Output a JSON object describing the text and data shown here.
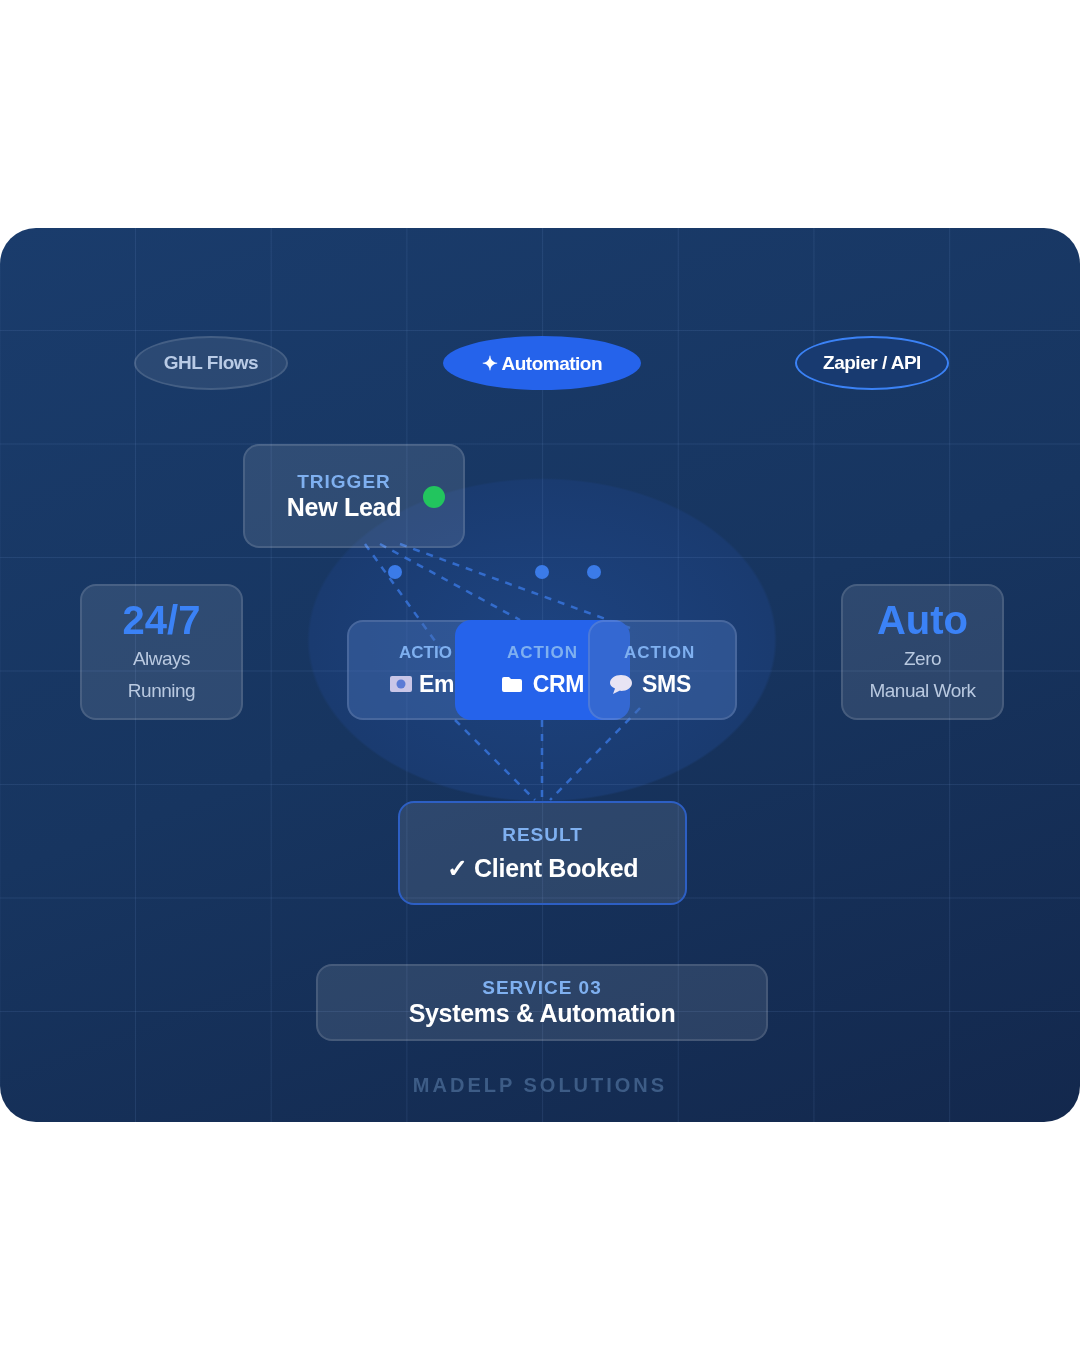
{
  "pills": [
    {
      "label": "GHL Flows",
      "kind": "muted"
    },
    {
      "label": "✦ Automation",
      "kind": "filled"
    },
    {
      "label": "Zapier / API",
      "kind": "outlined"
    }
  ],
  "trigger": {
    "label": "TRIGGER",
    "title": "New Lead",
    "color": "#22c55e"
  },
  "stats": [
    {
      "value": "24/7",
      "caption_lines": [
        "Always",
        "Running"
      ]
    },
    {
      "value": "Auto",
      "caption_lines": [
        "Zero",
        "Manual Work"
      ]
    }
  ],
  "actions": [
    {
      "label": "ACTIO",
      "name": "Em",
      "selected": false
    },
    {
      "label": "ACTION",
      "name": "CRM",
      "selected": true
    },
    {
      "label": "ACTION",
      "name": "SMS",
      "selected": false
    }
  ],
  "result": {
    "label": "RESULT",
    "title": "✓ Client Booked"
  },
  "service": {
    "label": "SERVICE 03",
    "title": "Systems & Automation"
  },
  "footer": "MADELP SOLUTIONS"
}
